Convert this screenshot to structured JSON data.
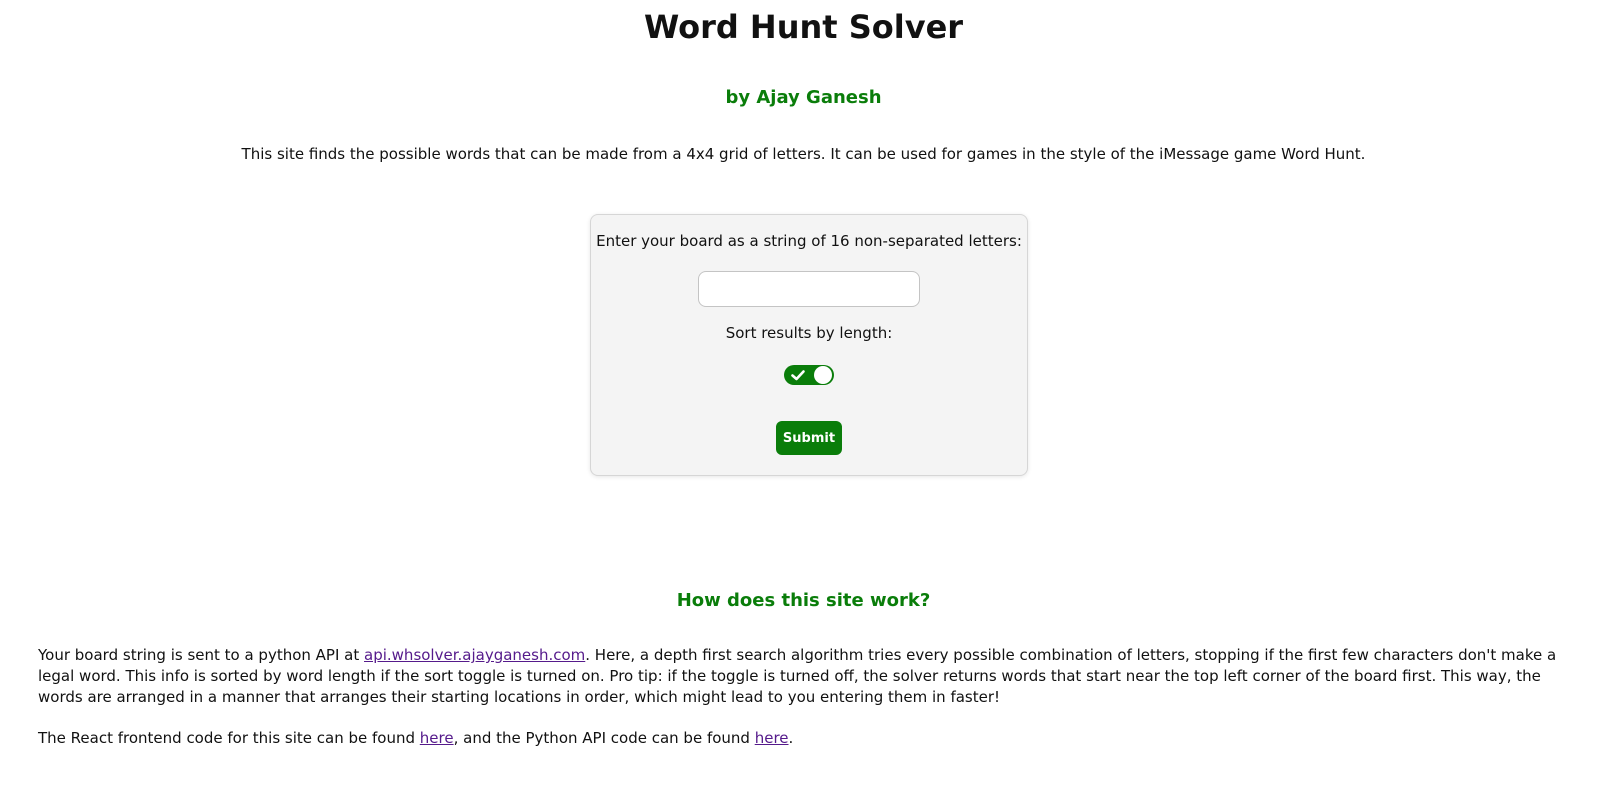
{
  "colors": {
    "accent": "#0a7d0a",
    "link_visited": "#551a8b",
    "card_background": "#f4f4f4"
  },
  "header": {
    "title": "Word Hunt Solver",
    "byline": "by Ajay Ganesh"
  },
  "intro": "This site finds the possible words that can be made from a 4x4 grid of letters. It can be used for games in the style of the iMessage game Word Hunt.",
  "form": {
    "board_label": "Enter your board as a string of 16 non-separated letters:",
    "board_value": "",
    "sort_label": "Sort results by length:",
    "sort_toggle_on": true,
    "toggle_icon": "check-icon",
    "submit_label": "Submit"
  },
  "how": {
    "heading": "How does this site work?",
    "p1_before": "Your board string is sent to a python API at ",
    "p1_link": "api.whsolver.ajayganesh.com",
    "p1_after": ". Here, a depth first search algorithm tries every possible combination of letters, stopping if the first few characters don't make a legal word. This info is sorted by word length if the sort toggle is turned on. Pro tip: if the toggle is turned off, the solver returns words that start near the top left corner of the board first. This way, the words are arranged in a manner that arranges their starting locations in order, which might lead to you entering them in faster!",
    "p2_before": "The React frontend code for this site can be found ",
    "p2_link1": "here",
    "p2_middle": ", and the Python API code can be found ",
    "p2_link2": "here",
    "p2_after": "."
  }
}
